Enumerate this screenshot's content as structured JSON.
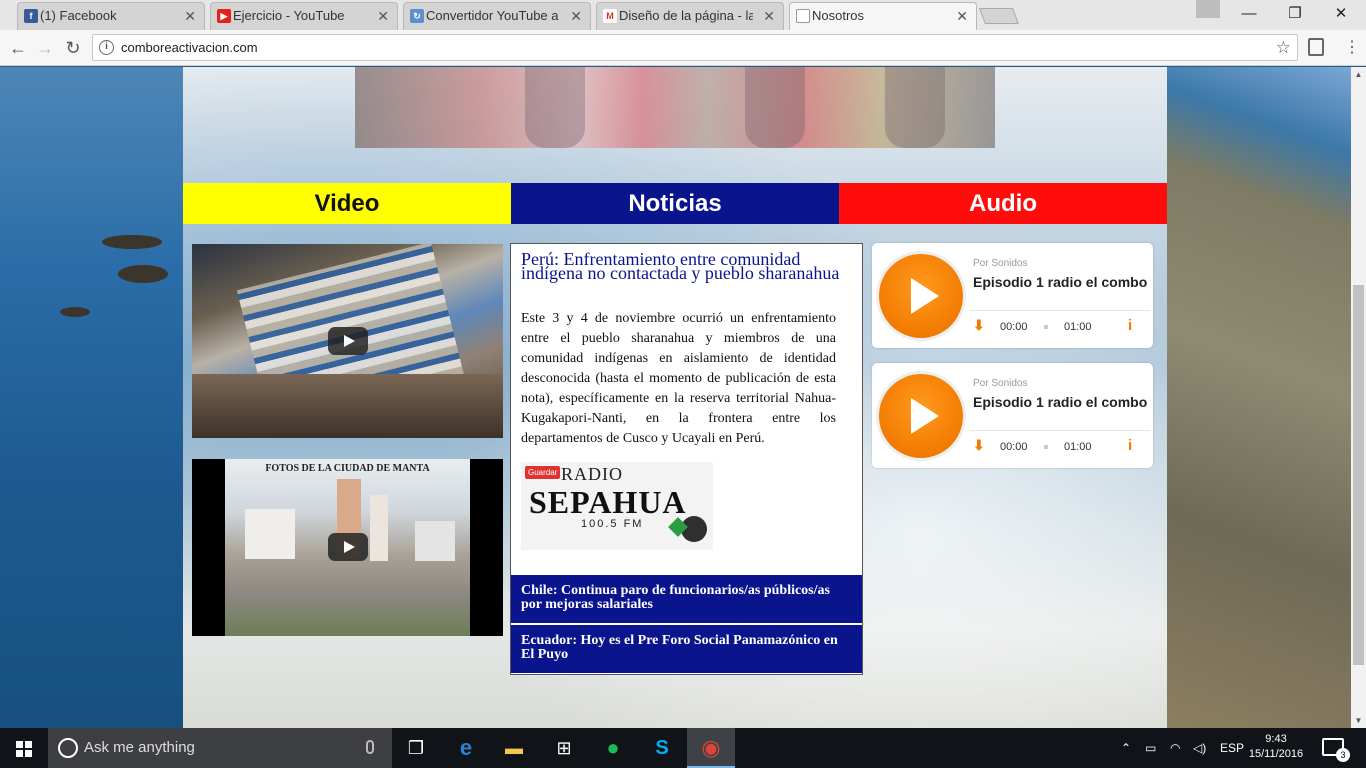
{
  "browser": {
    "tabs": [
      {
        "title": "(1) Facebook",
        "icon": "facebook-icon",
        "color": "#3b5998"
      },
      {
        "title": "Ejercicio - YouTube",
        "icon": "youtube-icon",
        "color": "#e62117"
      },
      {
        "title": "Convertidor YouTube a M",
        "icon": "converter-icon",
        "color": "#5a8fd0"
      },
      {
        "title": "Diseño de la página - lau",
        "icon": "gmail-icon",
        "color": "#d93025"
      },
      {
        "title": "Nosotros",
        "icon": "page-icon",
        "color": "#999999"
      }
    ],
    "address": "comboreactivacion.com",
    "window_buttons": {
      "minimize": "—",
      "restore": "❐",
      "close": "✕"
    }
  },
  "page": {
    "nav": {
      "video": "Video",
      "news": "Noticias",
      "audio": "Audio"
    },
    "video2_caption": "FOTOS DE LA CIUDAD DE MANTA",
    "news": {
      "headline": "Perú: Enfrentamiento entre comunidad indígena no contactada y pueblo sharanahua",
      "body": "Este 3 y 4 de noviembre ocurrió un enfrentamiento entre el pueblo sharanahua y miembros de una comunidad indígenas en aislamiento de identidad desconocida (hasta el momento de publicación de esta nota), específicamente en la reserva territorial Nahua-Kugakapori-Nanti, en la frontera entre los departamentos de Cusco y Ucayali en Perú.",
      "logo": {
        "save": "Guardar",
        "radio": "RADIO",
        "name": "SEPAHUA",
        "freq": "100.5 FM"
      },
      "items": [
        "Chile: Continua paro de funcionarios/as públicos/as por mejoras salariales",
        "Ecuador: Hoy es el Pre Foro Social Panamazónico en El Puyo"
      ]
    },
    "players": [
      {
        "by": "Por Sonidos",
        "episode": "Episodio 1 radio el combo",
        "current": "00:00",
        "duration": "01:00",
        "download": "⬇",
        "info": "i"
      },
      {
        "by": "Por Sonidos",
        "episode": "Episodio 1 radio el combo",
        "current": "00:00",
        "duration": "01:00",
        "download": "⬇",
        "info": "i"
      }
    ],
    "colors": {
      "video_tab": "#ffff00",
      "news_tab": "#0a148c",
      "audio_tab": "#ff0d0d",
      "player_accent": "#f27b00"
    }
  },
  "taskbar": {
    "search_placeholder": "Ask me anything",
    "language": "ESP",
    "time": "9:43",
    "date": "15/11/2016",
    "notifications": "3"
  }
}
